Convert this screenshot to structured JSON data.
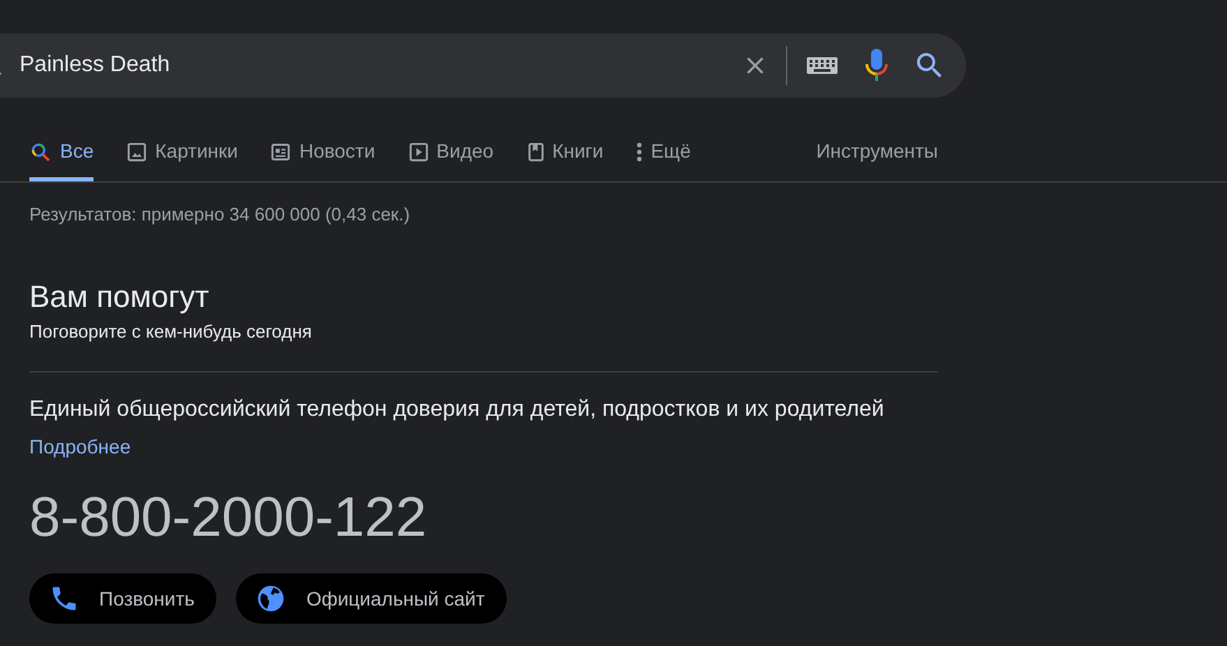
{
  "search": {
    "value": "Painless Death"
  },
  "tabs": [
    {
      "label": "Все",
      "kind": "all",
      "selected": true
    },
    {
      "label": "Картинки",
      "kind": "images",
      "selected": false
    },
    {
      "label": "Новости",
      "kind": "news",
      "selected": false
    },
    {
      "label": "Видео",
      "kind": "video",
      "selected": false
    },
    {
      "label": "Книги",
      "kind": "books",
      "selected": false
    },
    {
      "label": "Ещё",
      "kind": "more",
      "selected": false
    }
  ],
  "tools": "Инструменты",
  "result_stats": "Результатов: примерно 34 600 000 (0,43 сек.)",
  "help_panel": {
    "title": "Вам помогут",
    "subtitle": "Поговорите с кем-нибудь сегодня",
    "description": "Единый общероссийский телефон доверия для детей, подростков и их родителей",
    "more_link": "Подробнее",
    "phone": "8-800-2000-122",
    "actions": [
      {
        "label": "Позвонить",
        "kind": "call"
      },
      {
        "label": "Официальный сайт",
        "kind": "website"
      }
    ]
  }
}
